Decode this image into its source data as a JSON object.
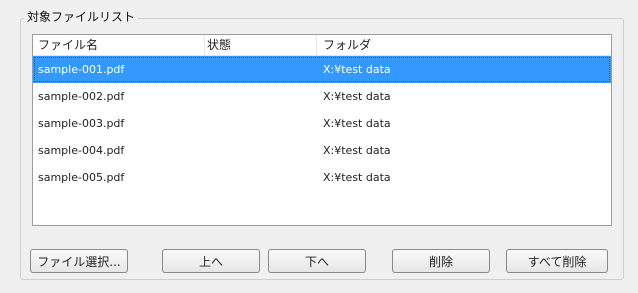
{
  "group": {
    "title": "対象ファイルリスト"
  },
  "list": {
    "columns": [
      "ファイル名",
      "状態",
      "フォルダ"
    ],
    "rows": [
      {
        "name": "sample-001.pdf",
        "status": "",
        "folder": "X:¥test data",
        "selected": true
      },
      {
        "name": "sample-002.pdf",
        "status": "",
        "folder": "X:¥test data",
        "selected": false
      },
      {
        "name": "sample-003.pdf",
        "status": "",
        "folder": "X:¥test data",
        "selected": false
      },
      {
        "name": "sample-004.pdf",
        "status": "",
        "folder": "X:¥test data",
        "selected": false
      },
      {
        "name": "sample-005.pdf",
        "status": "",
        "folder": "X:¥test data",
        "selected": false
      }
    ]
  },
  "buttons": {
    "select_files": "ファイル選択...",
    "move_up": "上へ",
    "move_down": "下へ",
    "delete": "削除",
    "delete_all": "すべて削除"
  },
  "colors": {
    "selection": "#3399ff",
    "window": "#f0f0f0"
  }
}
